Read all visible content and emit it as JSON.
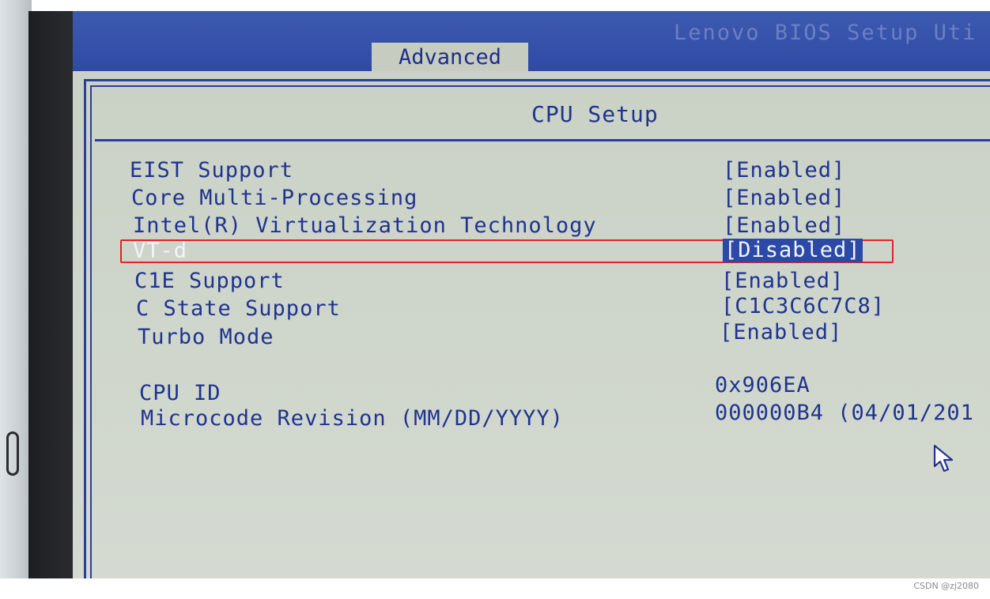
{
  "window": {
    "title": "Lenovo BIOS Setup Uti"
  },
  "tab": {
    "label": "Advanced"
  },
  "page": {
    "title": "CPU Setup"
  },
  "settings": [
    {
      "label": "EIST Support",
      "value": "[Enabled]"
    },
    {
      "label": "Core Multi-Processing",
      "value": "[Enabled]"
    },
    {
      "label": "Intel(R) Virtualization Technology",
      "value": "[Enabled]"
    },
    {
      "label": "VT-d",
      "value": "[Disabled]",
      "selected": true
    },
    {
      "label": "C1E Support",
      "value": "[Enabled]"
    },
    {
      "label": "C State Support",
      "value": "[C1C3C6C7C8]"
    },
    {
      "label": "Turbo Mode",
      "value": "[Enabled]"
    }
  ],
  "info": [
    {
      "label": "CPU ID",
      "value": "0x906EA"
    },
    {
      "label": "Microcode Revision (MM/DD/YYYY)",
      "value": "000000B4 (04/01/201"
    }
  ],
  "watermark": "CSDN @zj2080",
  "icons": {
    "cursor": "mouse-pointer-icon"
  },
  "colors": {
    "screen_bg": "#cdd4c9",
    "header_blue": "#2f4aa4",
    "text_blue": "#1f3390",
    "selection_red_box": "#e5222a"
  }
}
